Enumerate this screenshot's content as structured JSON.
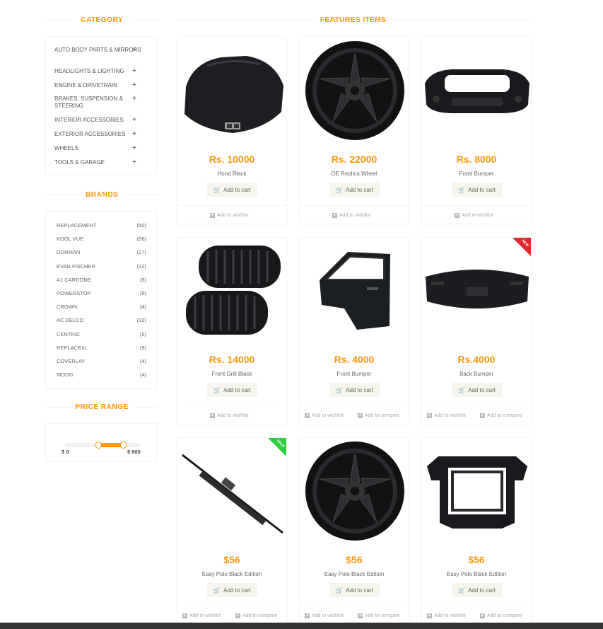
{
  "sidebar": {
    "category_title": "CATEGORY",
    "categories": [
      "AUTO BODY PARTS & MIRRORS",
      "HEADLIGHTS & LIGHTING",
      "ENGINE & DRIVETRAIN",
      "BRAKES, SUSPENSION & STEERING",
      "INTERIOR ACCESSORIES",
      "EXTERIOR ACCESSORIES",
      "WHEELS",
      "TOOLS & GARAGE"
    ],
    "brands_title": "BRANDS",
    "brands": [
      {
        "name": "REPLACEMENT",
        "count": "(50)"
      },
      {
        "name": "KOOL VUE",
        "count": "(56)"
      },
      {
        "name": "DORMAN",
        "count": "(27)"
      },
      {
        "name": "EVAN FISCHER",
        "count": "(32)"
      },
      {
        "name": "A1 CARDONE",
        "count": "(5)"
      },
      {
        "name": "POWERSTOP",
        "count": "(9)"
      },
      {
        "name": "CROWN",
        "count": "(4)"
      },
      {
        "name": "AC DELCO",
        "count": "(32)"
      },
      {
        "name": "CENTRIC",
        "count": "(5)"
      },
      {
        "name": "REPLACEXL",
        "count": "(9)"
      },
      {
        "name": "COVERLAY",
        "count": "(4)"
      },
      {
        "name": "MOOG",
        "count": "(4)"
      }
    ],
    "price_title": "PRICE RANGE",
    "price_min": "$ 0",
    "price_max": "$ 600",
    "price_selected_range": [
      200,
      400
    ]
  },
  "main": {
    "title": "FEATURES ITEMS",
    "cart_label": "Add to cart",
    "wishlist_label": "Add to wishlist",
    "compare_label": "Add to compare",
    "products": [
      {
        "price": "Rs. 10000",
        "name": "Hood Black",
        "image": "car-hood",
        "compare": false,
        "badge": ""
      },
      {
        "price": "Rs. 22000",
        "name": "OE Replica Wheel",
        "image": "alloy-wheel",
        "compare": false,
        "badge": ""
      },
      {
        "price": "Rs. 8000",
        "name": "Front Bumper",
        "image": "front-bumper",
        "compare": false,
        "badge": ""
      },
      {
        "price": "Rs. 14000",
        "name": "Front Grill Black",
        "image": "kidney-grill",
        "compare": false,
        "badge": ""
      },
      {
        "price": "Rs. 4000",
        "name": "Front Bumper",
        "image": "car-door",
        "compare": true,
        "badge": ""
      },
      {
        "price": "Rs.4000",
        "name": "Back Bumper",
        "image": "rear-bumper",
        "compare": true,
        "badge": "NEW"
      },
      {
        "price": "$56",
        "name": "Easy Polo Black Edition",
        "image": "wiper-blade",
        "compare": true,
        "badge": "SALE"
      },
      {
        "price": "$56",
        "name": "Easy Polo Black Edition",
        "image": "alloy-wheel",
        "compare": true,
        "badge": ""
      },
      {
        "price": "$56",
        "name": "Easy Polo Black Edition",
        "image": "radiator-support",
        "compare": true,
        "badge": ""
      }
    ]
  },
  "colors": {
    "accent": "#fe980f",
    "new_badge": "#e6262f",
    "sale_badge": "#2ecc40"
  }
}
